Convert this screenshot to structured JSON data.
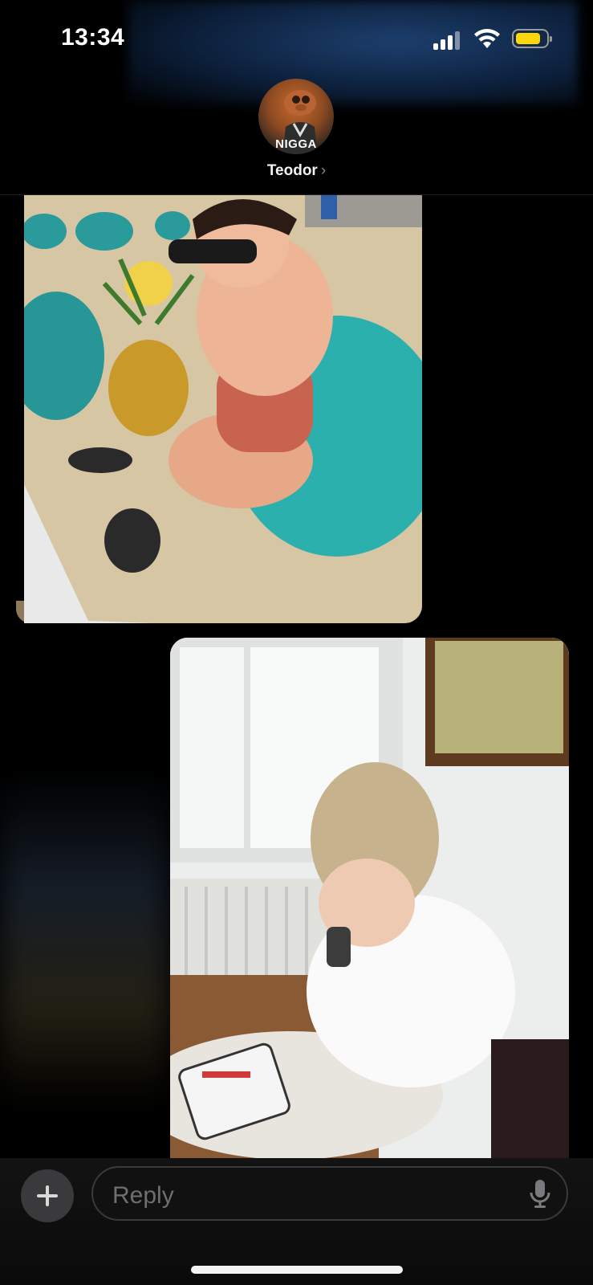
{
  "status_bar": {
    "time": "13:34",
    "icons": [
      "cellular-signal-icon",
      "wifi-icon",
      "battery-icon"
    ],
    "battery_color": "#ffd60a"
  },
  "header": {
    "avatar_text": "NIGGA",
    "contact_name": "Teodor",
    "chevron": "›"
  },
  "messages": [
    {
      "type": "photo",
      "side": "left",
      "description_icon": "photo-thumbnail"
    },
    {
      "type": "photo",
      "side": "right",
      "description_icon": "photo-thumbnail"
    }
  ],
  "composer": {
    "plus_symbol": "+",
    "placeholder": "Reply",
    "icons": [
      "plus-icon",
      "microphone-icon"
    ]
  },
  "colors": {
    "background": "#000000",
    "field_border": "#3a3a3c",
    "placeholder": "#6e6e73"
  }
}
